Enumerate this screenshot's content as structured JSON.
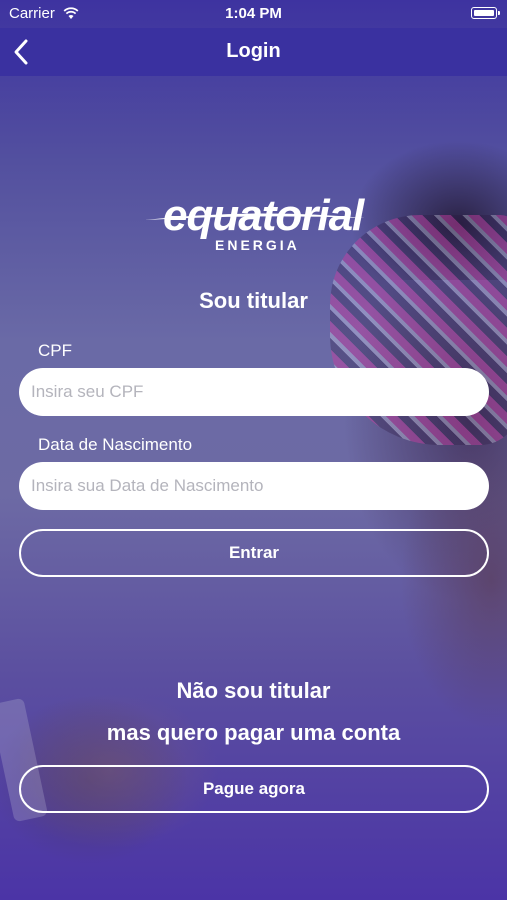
{
  "status_bar": {
    "carrier": "Carrier",
    "time": "1:04 PM",
    "wifi_icon": "wifi-icon",
    "battery_icon": "battery-icon"
  },
  "nav": {
    "title": "Login",
    "back_icon": "chevron-left-icon"
  },
  "brand": {
    "logo_word": "equatorial",
    "logo_sub": "ENERGIA"
  },
  "holder_section": {
    "heading": "Sou titular",
    "cpf": {
      "label": "CPF",
      "placeholder": "Insira seu CPF",
      "value": ""
    },
    "birth_date": {
      "label": "Data de Nascimento",
      "placeholder": "Insira sua Data de Nascimento",
      "value": ""
    },
    "submit_label": "Entrar"
  },
  "non_holder_section": {
    "heading_line1": "Não sou titular",
    "heading_line2": "mas quero pagar uma conta",
    "pay_label": "Pague agora"
  },
  "colors": {
    "nav_bg": "#3a31a0",
    "bg_top": "#3e33a0",
    "bg_bottom": "#4b34a6",
    "text": "#ffffff"
  }
}
